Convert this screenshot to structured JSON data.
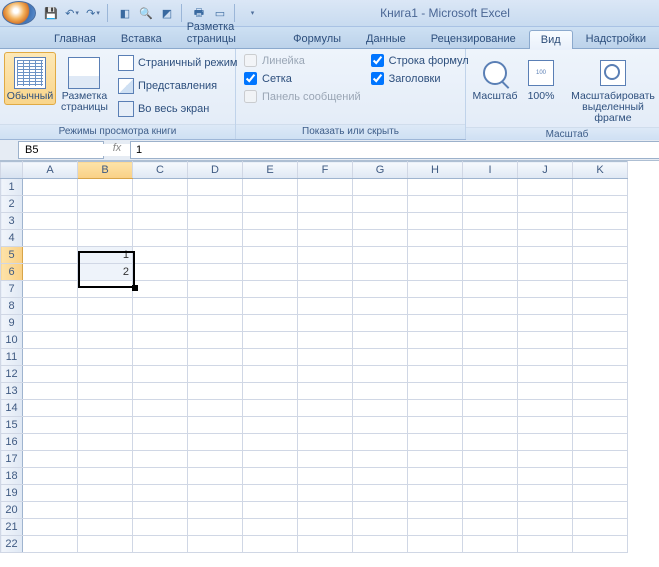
{
  "title": "Книга1 - Microsoft Excel",
  "tabs": [
    "Главная",
    "Вставка",
    "Разметка страницы",
    "Формулы",
    "Данные",
    "Рецензирование",
    "Вид",
    "Надстройки"
  ],
  "active_tab": 6,
  "ribbon": {
    "group_views": {
      "label": "Режимы просмотра книги",
      "normal": "Обычный",
      "page_layout": "Разметка\nстраницы",
      "page_break": "Страничный режим",
      "custom_views": "Представления",
      "full_screen": "Во весь экран"
    },
    "group_show": {
      "label": "Показать или скрыть",
      "ruler": "Линейка",
      "gridlines": "Сетка",
      "message_bar": "Панель сообщений",
      "formula_bar": "Строка формул",
      "headings": "Заголовки"
    },
    "group_zoom": {
      "label": "Масштаб",
      "zoom": "Масштаб",
      "z100": "100%",
      "zoom_selection": "Масштабировать\nвыделенный фрагме"
    }
  },
  "namebox": "B5",
  "formula": "1",
  "columns": [
    "A",
    "B",
    "C",
    "D",
    "E",
    "F",
    "G",
    "H",
    "I",
    "J",
    "K"
  ],
  "rows": 22,
  "cells": {
    "B5": "1",
    "B6": "2"
  },
  "selection": {
    "col": "B",
    "rows": [
      5,
      6
    ]
  }
}
